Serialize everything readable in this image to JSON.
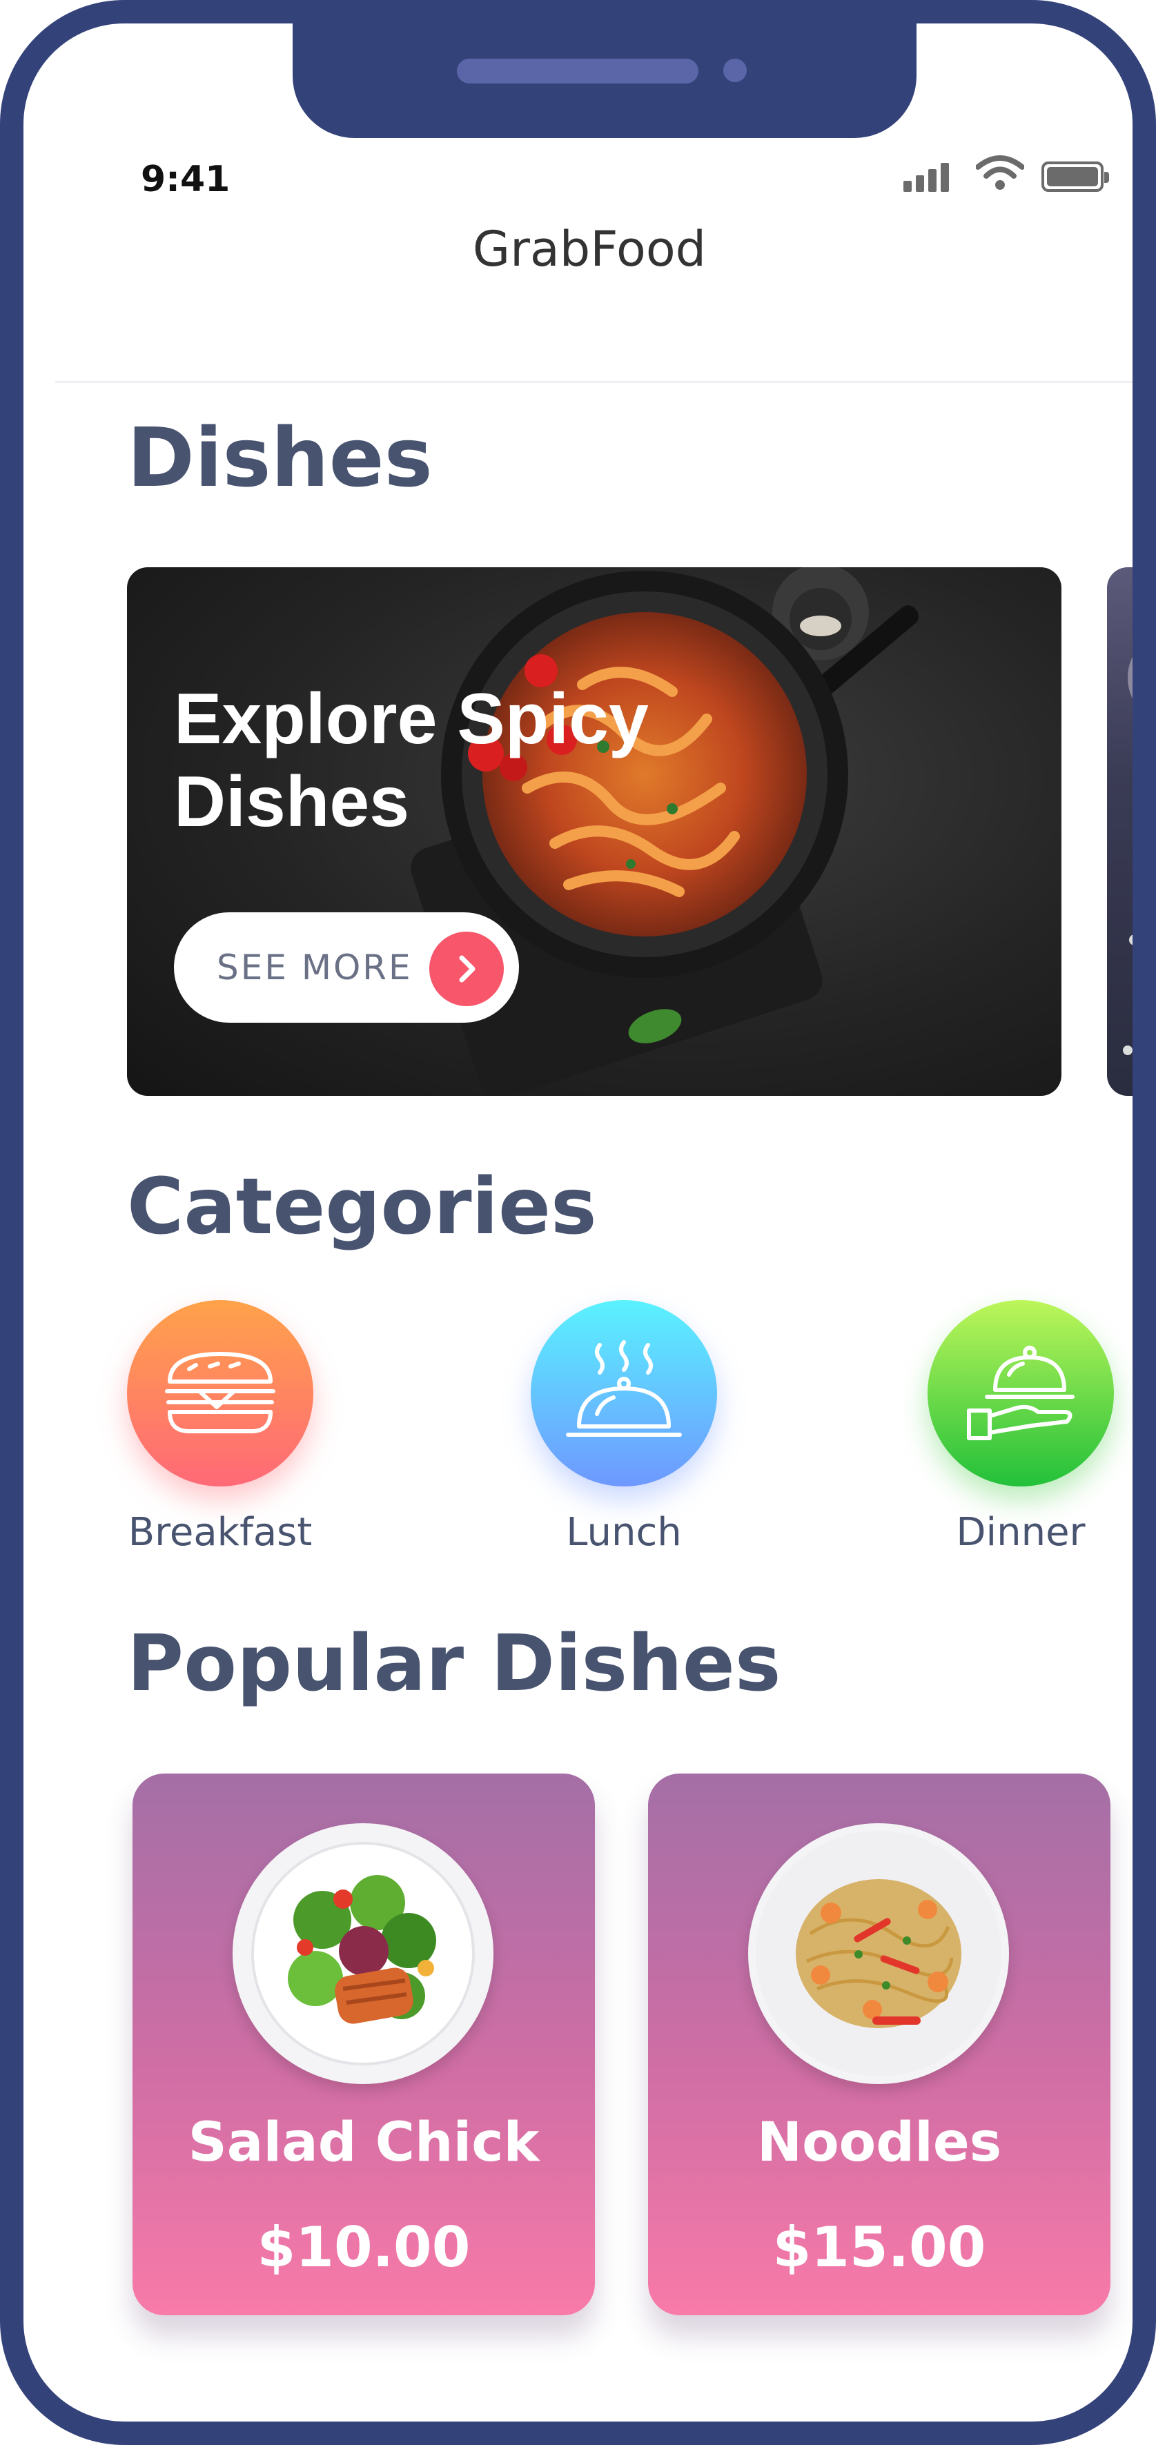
{
  "status_bar": {
    "time": "9:41"
  },
  "header": {
    "title": "GrabFood"
  },
  "dishes_section": {
    "title": "Dishes",
    "banner": {
      "text": "Explore Spicy Dishes",
      "button_label": "SEE MORE"
    }
  },
  "categories_section": {
    "title": "Categories",
    "items": [
      {
        "label": "Breakfast",
        "icon": "sandwich-icon"
      },
      {
        "label": "Lunch",
        "icon": "cloche-icon"
      },
      {
        "label": "Dinner",
        "icon": "serving-hand-icon"
      }
    ]
  },
  "popular_section": {
    "title": "Popular Dishes",
    "items": [
      {
        "name": "Salad Chick",
        "price": "$10.00"
      },
      {
        "name": "Noodles",
        "price": "$15.00"
      }
    ]
  },
  "colors": {
    "frame": "#34427a",
    "heading": "#48536f",
    "accent": "#f8566a",
    "breakfast_gradient": [
      "#ff9a4a",
      "#ff6f73"
    ],
    "lunch_gradient": [
      "#58f1ff",
      "#6d9dff"
    ],
    "dinner_gradient": [
      "#b7f55a",
      "#27c43a"
    ],
    "card_gradient": [
      "#a46fa6",
      "#f87aa8"
    ]
  }
}
